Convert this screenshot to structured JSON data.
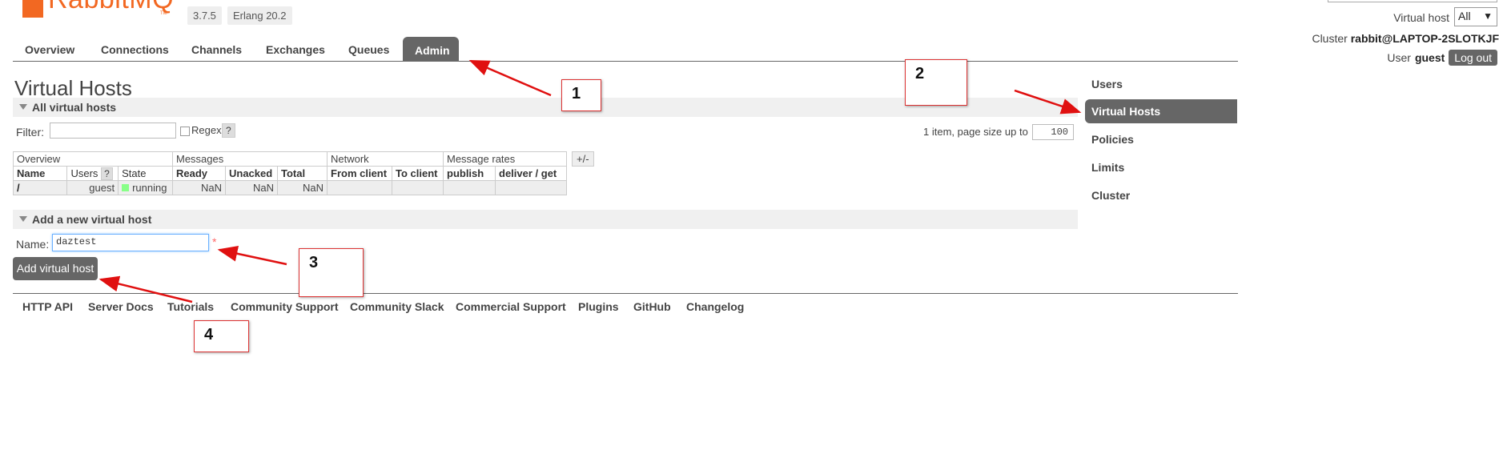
{
  "header": {
    "logo_text": "RabbitMQ",
    "logo_tm": "TM",
    "version": "3.7.5",
    "erlang": "Erlang 20.2",
    "vhost_label": "Virtual host",
    "vhost_value": "All",
    "cluster_label": "Cluster",
    "cluster_value": "rabbit@LAPTOP-2SLOTKJF",
    "user_label": "User",
    "user_value": "guest",
    "logout": "Log out"
  },
  "tabs": [
    {
      "label": "Overview"
    },
    {
      "label": "Connections"
    },
    {
      "label": "Channels"
    },
    {
      "label": "Exchanges"
    },
    {
      "label": "Queues"
    },
    {
      "label": "Admin",
      "active": true
    }
  ],
  "page_title": "Virtual Hosts",
  "all_vhosts": {
    "heading": "All virtual hosts",
    "filter_label": "Filter:",
    "regex_label": "Regex",
    "help": "?",
    "pagination_text": "1 item, page size up to",
    "page_size": "100",
    "column_toggle": "+/-",
    "groups": [
      "Overview",
      "Messages",
      "Network",
      "Message rates"
    ],
    "columns": [
      "Name",
      "Users",
      "State",
      "Ready",
      "Unacked",
      "Total",
      "From client",
      "To client",
      "publish",
      "deliver / get"
    ],
    "rows": [
      {
        "name": "/",
        "users": "guest",
        "state": "running",
        "ready": "NaN",
        "unacked": "NaN",
        "total": "NaN",
        "from_client": "",
        "to_client": "",
        "publish": "",
        "deliver_get": ""
      }
    ]
  },
  "add_vhost": {
    "heading": "Add a new virtual host",
    "name_label": "Name:",
    "name_value": "daztest",
    "required": "*",
    "button": "Add virtual host"
  },
  "sidebar": {
    "items": [
      {
        "label": "Users"
      },
      {
        "label": "Virtual Hosts",
        "active": true
      },
      {
        "label": "Policies"
      },
      {
        "label": "Limits"
      },
      {
        "label": "Cluster"
      }
    ]
  },
  "footer": {
    "links": [
      "HTTP API",
      "Server Docs",
      "Tutorials",
      "Community Support",
      "Community Slack",
      "Commercial Support",
      "Plugins",
      "GitHub",
      "Changelog"
    ]
  },
  "annotations": [
    "1",
    "2",
    "3",
    "4"
  ],
  "colors": {
    "brand": "#f26822",
    "tab_active": "#666666",
    "arrow": "#e01010"
  }
}
